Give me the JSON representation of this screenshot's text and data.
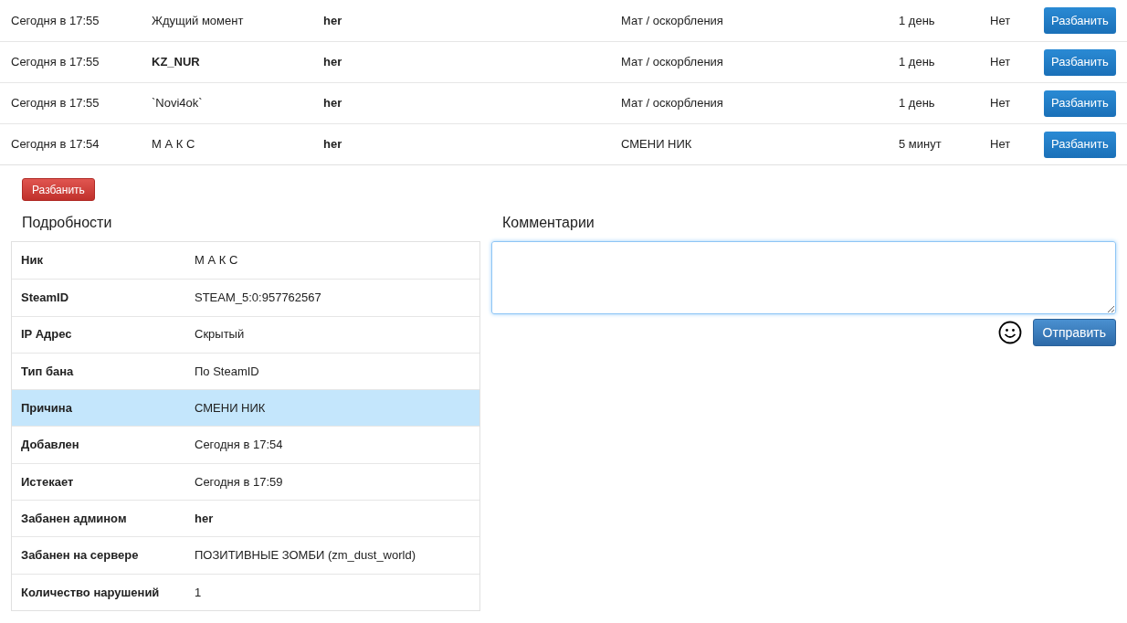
{
  "bans": [
    {
      "time": "Сегодня в 17:55",
      "player": "Ждущий момент",
      "player_bold": false,
      "admin": "her",
      "reason": "Мат / оскорбления",
      "duration": "1 день",
      "column_6": "Нет",
      "button": "Разбанить"
    },
    {
      "time": "Сегодня в 17:55",
      "player": "KZ_NUR",
      "player_bold": true,
      "admin": "her",
      "reason": "Мат / оскорбления",
      "duration": "1 день",
      "column_6": "Нет",
      "button": "Разбанить"
    },
    {
      "time": "Сегодня в 17:55",
      "player": "`Novi4ok`",
      "player_bold": false,
      "admin": "her",
      "reason": "Мат / оскорбления",
      "duration": "1 день",
      "column_6": "Нет",
      "button": "Разбанить"
    },
    {
      "time": "Сегодня в 17:54",
      "player": "М А К С",
      "player_bold": false,
      "admin": "her",
      "reason": "СМЕНИ НИК",
      "duration": "5 минут",
      "column_6": "Нет",
      "button": "Разбанить"
    }
  ],
  "unban_button": "Разбанить",
  "details": {
    "title": "Подробности",
    "rows": [
      {
        "label": "Ник",
        "value": "М А К С",
        "value_bold": false,
        "selected": false
      },
      {
        "label": "SteamID",
        "value": "STEAM_5:0:957762567",
        "value_bold": false,
        "selected": false
      },
      {
        "label": "IP Адрес",
        "value": "Скрытый",
        "value_bold": false,
        "selected": false
      },
      {
        "label": "Тип бана",
        "value": "По SteamID",
        "value_bold": false,
        "selected": false
      },
      {
        "label": "Причина",
        "value": "СМЕНИ НИК",
        "value_bold": false,
        "selected": true
      },
      {
        "label": "Добавлен",
        "value": "Сегодня в 17:54",
        "value_bold": false,
        "selected": false
      },
      {
        "label": "Истекает",
        "value": "Сегодня в 17:59",
        "value_bold": false,
        "selected": false
      },
      {
        "label": "Забанен админом",
        "value": "her",
        "value_bold": true,
        "selected": false
      },
      {
        "label": "Забанен на сервере",
        "value": "ПОЗИТИВНЫЕ ЗОМБИ (zm_dust_world)",
        "value_bold": false,
        "selected": false
      },
      {
        "label": "Количество нарушений",
        "value": "1",
        "value_bold": false,
        "selected": false
      }
    ]
  },
  "comments": {
    "title": "Комментарии",
    "send_button": "Отправить"
  }
}
